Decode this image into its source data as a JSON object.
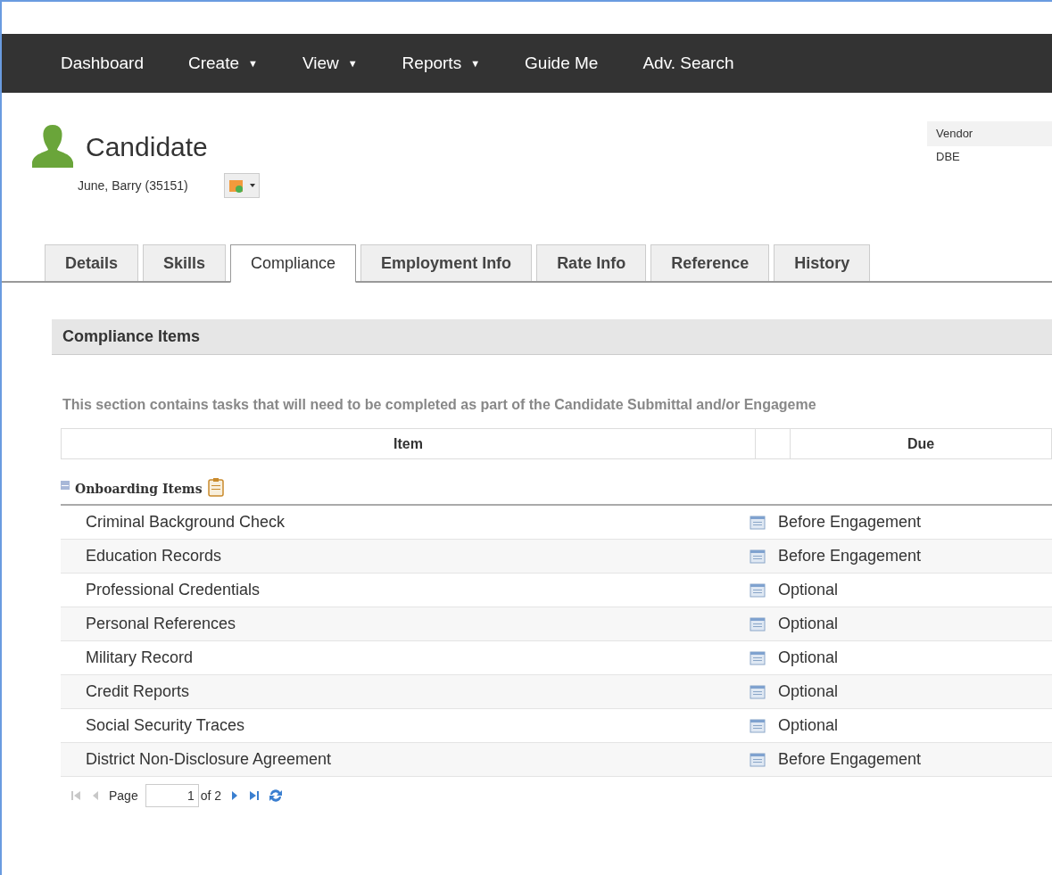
{
  "nav": [
    {
      "label": "Dashboard",
      "dropdown": false
    },
    {
      "label": "Create",
      "dropdown": true
    },
    {
      "label": "View",
      "dropdown": true
    },
    {
      "label": "Reports",
      "dropdown": true
    },
    {
      "label": "Guide Me",
      "dropdown": false
    },
    {
      "label": "Adv. Search",
      "dropdown": false
    }
  ],
  "nav_caret": "▼",
  "header": {
    "title": "Candidate",
    "subtitle": "June, Barry (35151)",
    "vendor_label": "Vendor",
    "vendor_value": "DBE"
  },
  "tabs": [
    {
      "label": "Details",
      "selected": false
    },
    {
      "label": "Skills",
      "selected": false
    },
    {
      "label": "Compliance",
      "selected": true
    },
    {
      "label": "Employment Info",
      "selected": false
    },
    {
      "label": "Rate Info",
      "selected": false
    },
    {
      "label": "Reference",
      "selected": false
    },
    {
      "label": "History",
      "selected": false
    }
  ],
  "section": {
    "title": "Compliance Items",
    "description": "This section contains tasks that will need to be completed as part of the Candidate Submittal and/or Engageme"
  },
  "table": {
    "columns": [
      "Item",
      "Due"
    ],
    "group": {
      "label": "Onboarding Items",
      "expanded": true
    },
    "rows": [
      {
        "item": "Criminal Background Check",
        "due": "Before Engagement"
      },
      {
        "item": "Education Records",
        "due": "Before Engagement"
      },
      {
        "item": "Professional Credentials",
        "due": "Optional"
      },
      {
        "item": "Personal References",
        "due": "Optional"
      },
      {
        "item": "Military Record",
        "due": "Optional"
      },
      {
        "item": "Credit Reports",
        "due": "Optional"
      },
      {
        "item": "Social Security Traces",
        "due": "Optional"
      },
      {
        "item": "District Non-Disclosure Agreement",
        "due": "Before Engagement"
      }
    ]
  },
  "pager": {
    "label": "Page",
    "value": "1",
    "of": "of 2",
    "first_disabled": true,
    "prev_disabled": true
  }
}
